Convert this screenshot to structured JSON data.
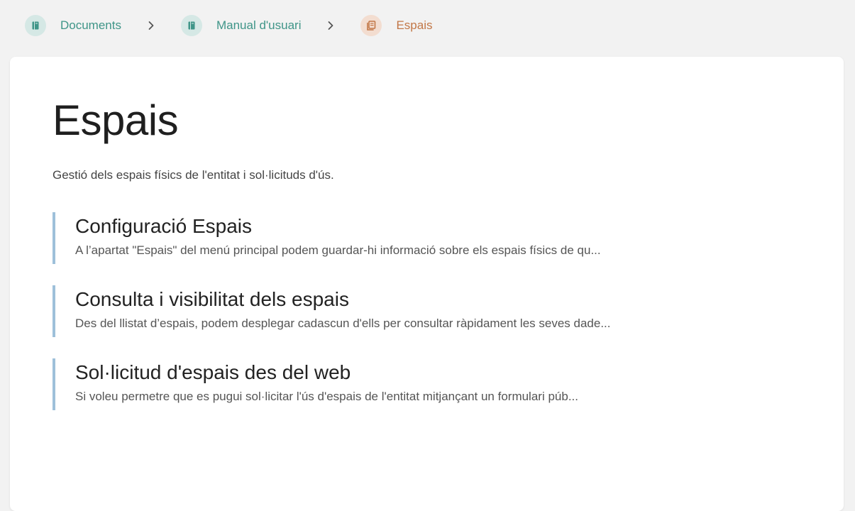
{
  "breadcrumb": {
    "items": [
      {
        "label": "Documents",
        "icon": "book-icon",
        "color": "#3f9588"
      },
      {
        "label": "Manual d'usuari",
        "icon": "book-icon",
        "color": "#3f9588"
      },
      {
        "label": "Espais",
        "icon": "chapter-icon",
        "color": "#c27747"
      }
    ],
    "separator_icon": "chevron-right-icon"
  },
  "page": {
    "title": "Espais",
    "description": "Gestió dels espais físics de l'entitat i sol·licituds d'ús."
  },
  "entries": [
    {
      "title": "Configuració Espais",
      "excerpt": "A l’apartat \"Espais\" del menú principal podem guardar-hi informació sobre els espais físics de qu..."
    },
    {
      "title": "Consulta i visibilitat dels espais",
      "excerpt": "Des del llistat d’espais, podem desplegar cadascun d'ells per consultar ràpidament les seves dade..."
    },
    {
      "title": "Sol·licitud d'espais des del web",
      "excerpt": "Si voleu permetre que es pugui sol·licitar l'ús d'espais de l'entitat mitjançant un formulari púb..."
    }
  ],
  "colors": {
    "background": "#f2f2f2",
    "card": "#ffffff",
    "entry_border": "#9ec0da",
    "book_accent": "#3f9588",
    "chapter_accent": "#c27747"
  }
}
